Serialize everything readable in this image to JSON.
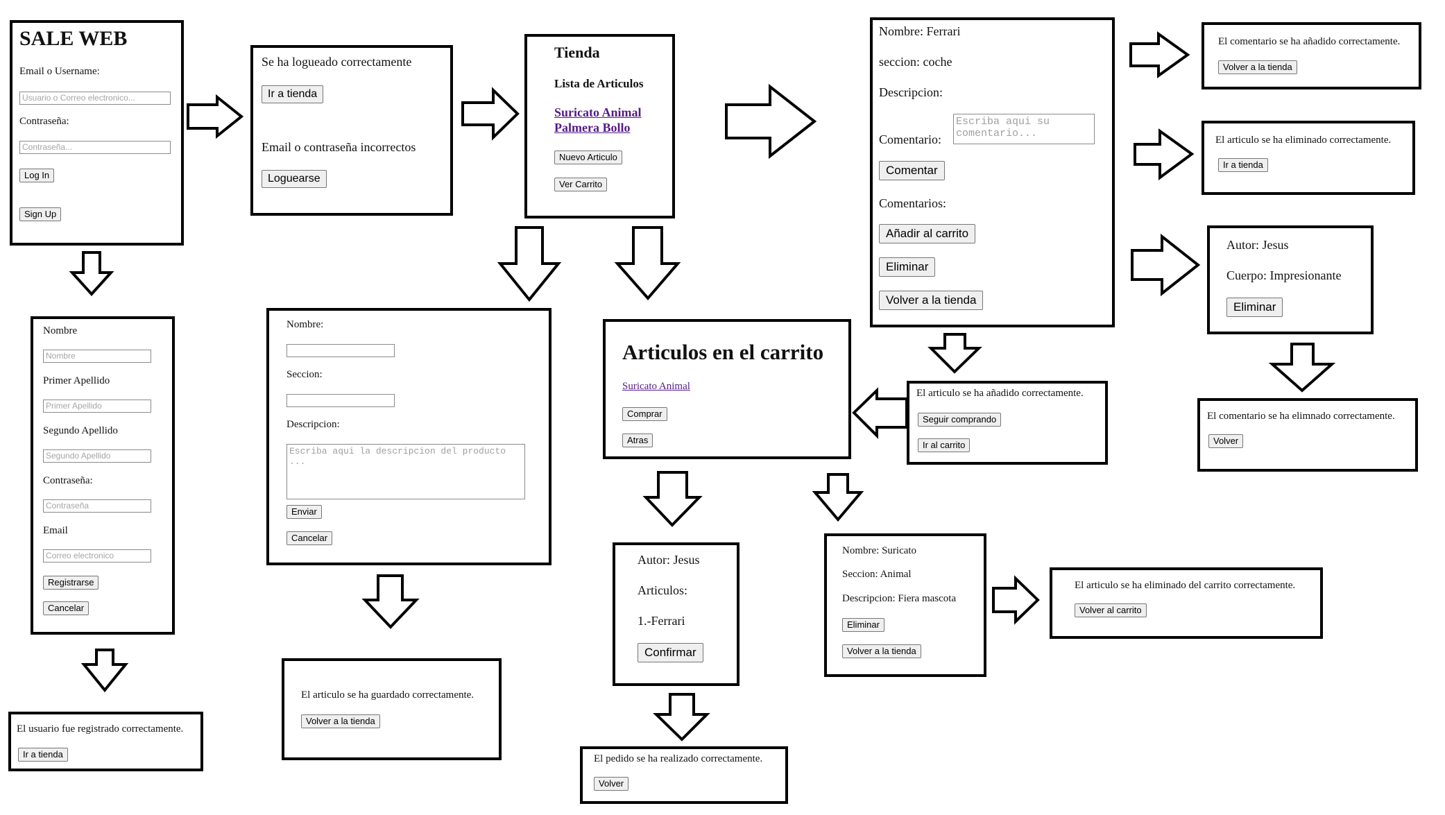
{
  "login": {
    "title": "SALE WEB",
    "email_label": "Email o Username:",
    "email_placeholder": "Usuario o Correo electronico...",
    "password_label": "Contraseña:",
    "password_placeholder": "Contraseña...",
    "login_button": "Log In",
    "signup_button": "Sign Up"
  },
  "login_result": {
    "success_text": "Se ha logueado correctamente",
    "go_store_button": "Ir a tienda",
    "error_text": "Email o contraseña incorrectos",
    "retry_button": "Loguearse"
  },
  "store": {
    "title": "Tienda",
    "list_title": "Lista de Articulos",
    "items": [
      "Suricato Animal",
      "Palmera Bollo"
    ],
    "new_article_button": "Nuevo Articulo",
    "view_cart_button": "Ver Carrito"
  },
  "article_detail": {
    "name": "Nombre: Ferrari",
    "section": "seccion: coche",
    "description": "Descripcion:",
    "comment_label": "Comentario:",
    "comment_placeholder": "Escriba aqui su comentario...",
    "comment_button": "Comentar",
    "comments_label": "Comentarios:",
    "add_cart_button": "Añadir al carrito",
    "delete_button": "Eliminar",
    "back_button": "Volver a la tienda"
  },
  "comment_added": {
    "text": "El comentario se ha añadido correctamente.",
    "button": "Volver a la tienda"
  },
  "article_deleted": {
    "text": "El articulo se ha eliminado correctamente.",
    "button": "Ir a tienda"
  },
  "comment_view": {
    "author": "Autor: Jesus",
    "body": "Cuerpo: Impresionante",
    "delete_button": "Eliminar"
  },
  "comment_deleted": {
    "text": "El comentario se ha elimnado correctamente.",
    "button": "Volver"
  },
  "signup": {
    "name_label": "Nombre",
    "name_placeholder": "Nombre",
    "surname1_label": "Primer Apellido",
    "surname1_placeholder": "Primer Apellido",
    "surname2_label": "Segundo Apellido",
    "surname2_placeholder": "Segundo Apellido",
    "password_label": "Contraseña:",
    "password_placeholder": "Contraseña",
    "email_label": "Email",
    "email_placeholder": "Correo electronico",
    "register_button": "Registrarse",
    "cancel_button": "Cancelar"
  },
  "user_registered": {
    "text": "El usuario fue registrado correctamente.",
    "button": "Ir a tienda"
  },
  "new_article": {
    "name_label": "Nombre:",
    "section_label": "Seccion:",
    "description_label": "Descripcion:",
    "description_placeholder": "Escriba aqui la descripcion del producto ...",
    "send_button": "Enviar",
    "cancel_button": "Cancelar"
  },
  "article_saved": {
    "text": "El articulo se ha guardado correctamente.",
    "button": "Volver a la tienda"
  },
  "cart": {
    "title": "Articulos en el carrito",
    "item": "Suricato Animal",
    "buy_button": "Comprar",
    "back_button": "Atras"
  },
  "added_to_cart": {
    "text": "El articulo se ha añadido correctamente.",
    "continue_button": "Seguir comprando",
    "cart_button": "Ir al carrito"
  },
  "order_confirm": {
    "author": "Autor: Jesus",
    "articles_label": "Articulos:",
    "article_item": "1.-Ferrari",
    "confirm_button": "Confirmar"
  },
  "order_done": {
    "text": "El pedido se ha realizado correctamente.",
    "button": "Volver"
  },
  "cart_item_detail": {
    "name": "Nombre: Suricato",
    "section": "Seccion: Animal",
    "description": "Descripcion: Fiera mascota",
    "delete_button": "Eliminar",
    "back_button": "Volver a la tienda"
  },
  "cart_item_deleted": {
    "text": "El articulo se ha eliminado del carrito correctamente.",
    "button": "Volver al carrito"
  }
}
